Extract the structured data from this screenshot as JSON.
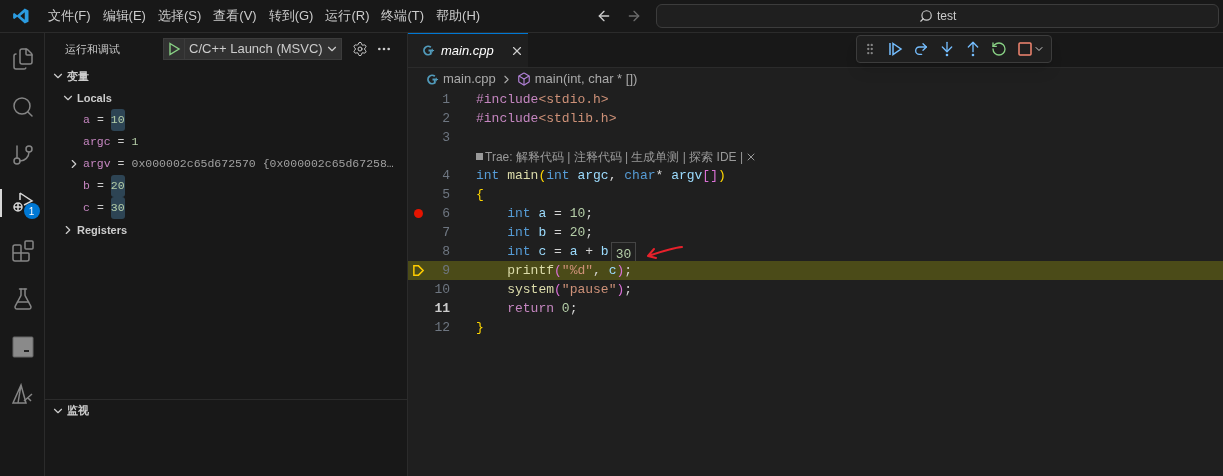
{
  "menu": [
    "文件(F)",
    "编辑(E)",
    "选择(S)",
    "查看(V)",
    "转到(G)",
    "运行(R)",
    "终端(T)",
    "帮助(H)"
  ],
  "search": {
    "value": "test"
  },
  "activity_bar": [
    {
      "kind": "files",
      "selected": false
    },
    {
      "kind": "search",
      "selected": false
    },
    {
      "kind": "git",
      "selected": false
    },
    {
      "kind": "debug",
      "selected": true,
      "badge": "1"
    },
    {
      "kind": "extensions",
      "selected": false
    },
    {
      "kind": "testing",
      "selected": false
    },
    {
      "kind": "terminal",
      "selected": false
    },
    {
      "kind": "tool",
      "selected": false
    }
  ],
  "sidebar": {
    "title": "运行和调试",
    "config": "C/C++ Launch (MSVC)",
    "variables": {
      "title": "变量",
      "expanded": true,
      "scopes": [
        {
          "name": "Locals",
          "expanded": true,
          "children": [
            {
              "name": "a",
              "operator": "=",
              "value": "10",
              "changed": true,
              "expandable": false
            },
            {
              "name": "argc",
              "operator": "=",
              "value": "1",
              "changed": false,
              "expandable": false
            },
            {
              "name": "argv",
              "operator": "=",
              "value": "0x000002c65d672570 {0x000002c65d67258…",
              "changed": false,
              "expandable": true
            },
            {
              "name": "b",
              "operator": "=",
              "value": "20",
              "changed": true,
              "expandable": false
            },
            {
              "name": "c",
              "operator": "=",
              "value": "30",
              "changed": true,
              "expandable": false
            }
          ]
        },
        {
          "name": "Registers",
          "expanded": false
        }
      ]
    },
    "watch": {
      "title": "监视",
      "expanded": true
    }
  },
  "tab": {
    "label": "main.cpp",
    "selected": true
  },
  "breadcrumbs": [
    "main.cpp",
    "main(int, char * [])"
  ],
  "code": [
    {
      "kind": "line",
      "number": "1",
      "breakpoint": false,
      "current": false,
      "tokens": [
        {
          "text": "#include",
          "kind": "pre"
        },
        {
          "text": "<stdio.h>",
          "kind": "str"
        }
      ]
    },
    {
      "kind": "line",
      "number": "2",
      "breakpoint": false,
      "current": false,
      "tokens": [
        {
          "text": "#include",
          "kind": "pre"
        },
        {
          "text": "<stdlib.h>",
          "kind": "str"
        }
      ]
    },
    {
      "kind": "line",
      "number": "3",
      "breakpoint": false,
      "current": false
    },
    {
      "kind": "lens",
      "text": "Trae: 解释代码 | 注释代码 | 生成单测 | 探索 IDE |"
    },
    {
      "kind": "line",
      "number": "4",
      "breakpoint": false,
      "current": false,
      "tokens": [
        {
          "text": "int ",
          "kind": "kw"
        },
        {
          "text": "main",
          "kind": "fn"
        },
        {
          "text": "(",
          "kind": "br"
        },
        {
          "text": "int ",
          "kind": "kw"
        },
        {
          "text": "argc",
          "kind": "var"
        },
        {
          "text": ", ",
          "kind": "p"
        },
        {
          "text": "char",
          "kind": "kw"
        },
        {
          "text": "* ",
          "kind": "p"
        },
        {
          "text": "argv",
          "kind": "var"
        },
        {
          "text": "[]",
          "kind": "br2"
        },
        {
          "text": ")",
          "kind": "br"
        }
      ]
    },
    {
      "kind": "line",
      "number": "5",
      "breakpoint": false,
      "current": false,
      "tokens": [
        {
          "text": "{",
          "kind": "br"
        }
      ]
    },
    {
      "kind": "line",
      "number": "6",
      "breakpoint": true,
      "current": false,
      "tokens": [
        {
          "text": "    int ",
          "kind": "kw"
        },
        {
          "text": "a",
          "kind": "var"
        },
        {
          "text": " = ",
          "kind": "p"
        },
        {
          "text": "10",
          "kind": "num"
        },
        {
          "text": ";",
          "kind": "p"
        }
      ]
    },
    {
      "kind": "line",
      "number": "7",
      "breakpoint": false,
      "current": false,
      "tokens": [
        {
          "text": "    int ",
          "kind": "kw"
        },
        {
          "text": "b",
          "kind": "var"
        },
        {
          "text": " = ",
          "kind": "p"
        },
        {
          "text": "20",
          "kind": "num"
        },
        {
          "text": ";",
          "kind": "p"
        }
      ]
    },
    {
      "kind": "line",
      "number": "8",
      "breakpoint": false,
      "current": false,
      "inline_value": "30",
      "tokens": [
        {
          "text": "    int ",
          "kind": "kw"
        },
        {
          "text": "c",
          "kind": "var"
        },
        {
          "text": " = ",
          "kind": "p"
        },
        {
          "text": "a",
          "kind": "var"
        },
        {
          "text": " + ",
          "kind": "p"
        },
        {
          "text": "b",
          "kind": "var"
        }
      ]
    },
    {
      "kind": "line",
      "number": "9",
      "breakpoint": false,
      "current": true,
      "tokens": [
        {
          "text": "    printf",
          "kind": "fn"
        },
        {
          "text": "(",
          "kind": "br2"
        },
        {
          "text": "\"%d\"",
          "kind": "str"
        },
        {
          "text": ", ",
          "kind": "p"
        },
        {
          "text": "c",
          "kind": "var"
        },
        {
          "text": ")",
          "kind": "br2"
        },
        {
          "text": ";",
          "kind": "p"
        }
      ]
    },
    {
      "kind": "line",
      "number": "10",
      "breakpoint": false,
      "current": false,
      "tokens": [
        {
          "text": "    system",
          "kind": "fn"
        },
        {
          "text": "(",
          "kind": "br2"
        },
        {
          "text": "\"pause\"",
          "kind": "str"
        },
        {
          "text": ")",
          "kind": "br2"
        },
        {
          "text": ";",
          "kind": "p"
        }
      ]
    },
    {
      "kind": "line",
      "number": "11",
      "breakpoint": false,
      "current": false,
      "cursor": true,
      "tokens": [
        {
          "text": "    return ",
          "kind": "ctl"
        },
        {
          "text": "0",
          "kind": "num"
        },
        {
          "text": ";",
          "kind": "p"
        }
      ]
    },
    {
      "kind": "line",
      "number": "12",
      "breakpoint": false,
      "current": false,
      "tokens": [
        {
          "text": "}",
          "kind": "br"
        }
      ]
    }
  ]
}
